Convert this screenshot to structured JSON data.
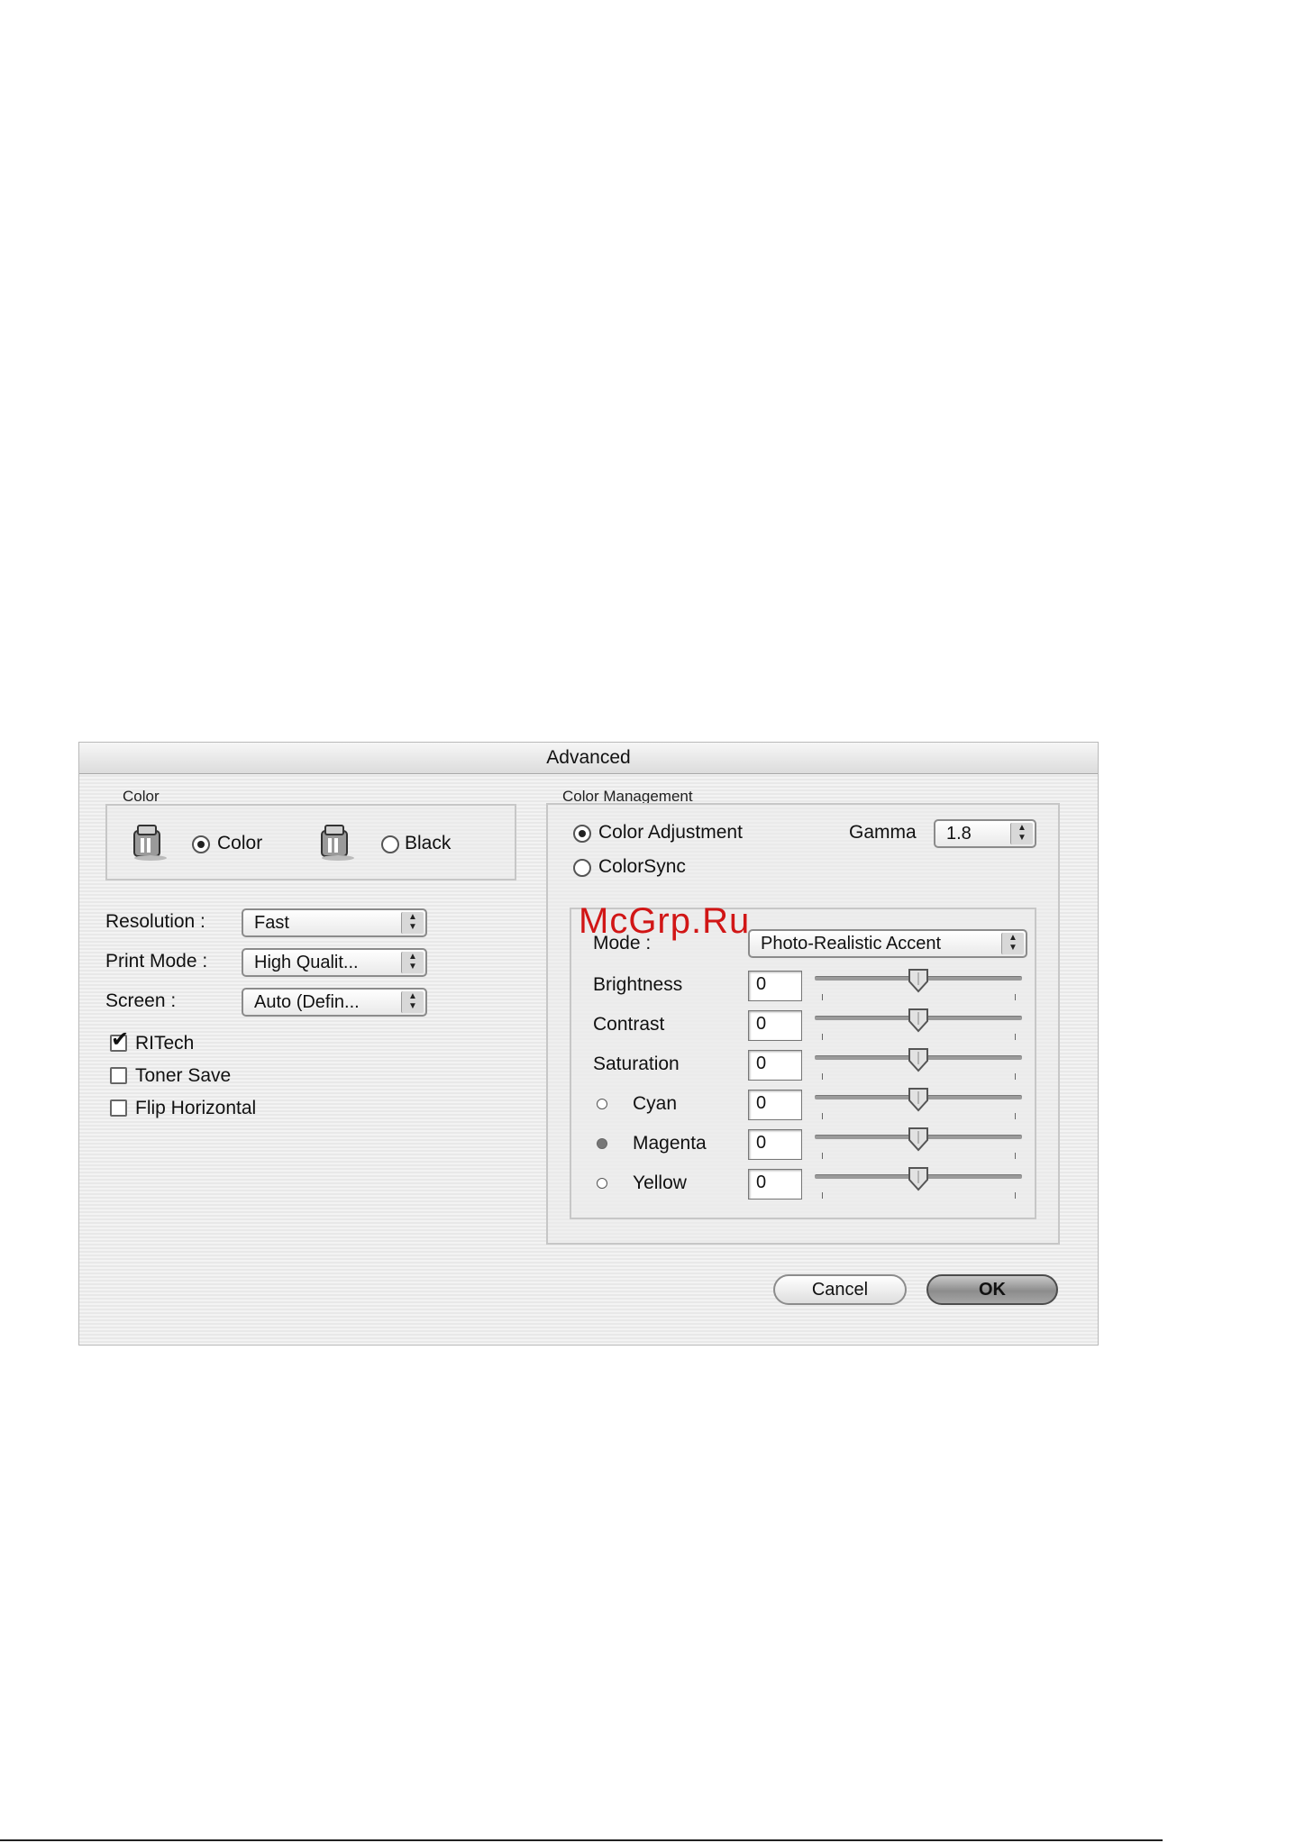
{
  "dialog": {
    "title": "Advanced",
    "buttons": {
      "cancel": "Cancel",
      "ok": "OK"
    }
  },
  "color_group": {
    "label": "Color",
    "options": [
      {
        "label": "Color",
        "selected": true,
        "icon": "printer-cartridge-icon"
      },
      {
        "label": "Black",
        "selected": false,
        "icon": "printer-cartridge-icon"
      }
    ]
  },
  "settings": {
    "resolution": {
      "label": "Resolution :",
      "value": "Fast"
    },
    "print_mode": {
      "label": "Print Mode :",
      "value": "High Qualit..."
    },
    "screen": {
      "label": "Screen :",
      "value": "Auto (Defin..."
    }
  },
  "checkboxes": [
    {
      "label": "RITech",
      "checked": true
    },
    {
      "label": "Toner Save",
      "checked": false
    },
    {
      "label": "Flip Horizontal",
      "checked": false
    }
  ],
  "color_management": {
    "label": "Color Management",
    "options": [
      {
        "label": "Color Adjustment",
        "selected": true
      },
      {
        "label": "ColorSync",
        "selected": false
      }
    ],
    "gamma": {
      "label": "Gamma",
      "value": "1.8"
    },
    "mode": {
      "label": "Mode :",
      "value": "Photo-Realistic Accent"
    },
    "sliders": [
      {
        "label": "Brightness",
        "value": "0",
        "level": 0.5
      },
      {
        "label": "Contrast",
        "value": "0",
        "level": 0.5
      },
      {
        "label": "Saturation",
        "value": "0",
        "level": 0.5
      },
      {
        "label": "Cyan",
        "value": "0",
        "level": 0.5,
        "radio": false
      },
      {
        "label": "Magenta",
        "value": "0",
        "level": 0.5,
        "radio": true
      },
      {
        "label": "Yellow",
        "value": "0",
        "level": 0.5,
        "radio": false
      }
    ]
  },
  "watermark": "McGrp.Ru",
  "colors": {
    "watermark": "#d11616",
    "ok_button": "#8c8c8c"
  }
}
